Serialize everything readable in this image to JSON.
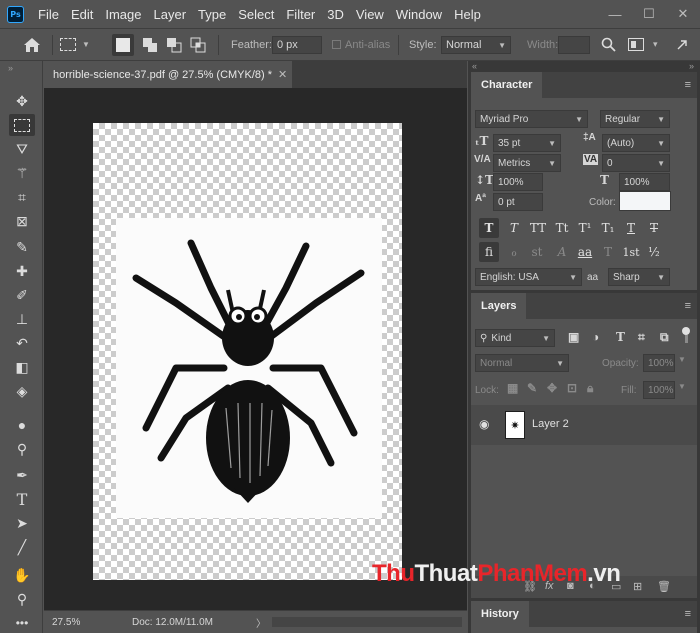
{
  "app": {
    "logo": "Ps"
  },
  "menu": [
    "File",
    "Edit",
    "Image",
    "Layer",
    "Type",
    "Select",
    "Filter",
    "3D",
    "View",
    "Window",
    "Help"
  ],
  "window_controls": {
    "minimize": "—",
    "maximize": "☐",
    "close": "✕"
  },
  "options": {
    "feather_label": "Feather:",
    "feather_value": "0 px",
    "antialias_label": "Anti-alias",
    "style_label": "Style:",
    "style_value": "Normal",
    "width_label": "Width:"
  },
  "document": {
    "tab_title": "horrible-science-37.pdf @ 27.5% (CMYK/8) *",
    "zoom": "27.5%",
    "doc_info": "Doc: 12.0M/11.0M"
  },
  "character": {
    "panel_title": "Character",
    "font_family": "Myriad Pro",
    "font_style": "Regular",
    "size": "35 pt",
    "leading": "(Auto)",
    "kerning": "Metrics",
    "tracking": "0",
    "vertical_scale": "100%",
    "horizontal_scale": "100%",
    "baseline_shift": "0 pt",
    "color_label": "Color:",
    "language": "English: USA",
    "aa_icon": "aa",
    "antialias": "Sharp",
    "type_buttons": [
      "T",
      "T",
      "TT",
      "Tt",
      "T¹",
      "T₁",
      "T",
      "T"
    ],
    "opentype_buttons": [
      "fi",
      "ℴ",
      "st",
      "A",
      "aa",
      "T",
      "1st",
      "½"
    ]
  },
  "layers": {
    "panel_title": "Layers",
    "filter_kind": "Kind",
    "blend_mode": "Normal",
    "opacity_label": "Opacity:",
    "opacity_value": "100%",
    "lock_label": "Lock:",
    "fill_label": "Fill:",
    "fill_value": "100%",
    "layer_name": "Layer 2"
  },
  "history": {
    "panel_title": "History"
  },
  "watermark": {
    "part1": "Thu",
    "part2": "Thuat",
    "part3": "PhanMem",
    "part4": ".vn"
  }
}
